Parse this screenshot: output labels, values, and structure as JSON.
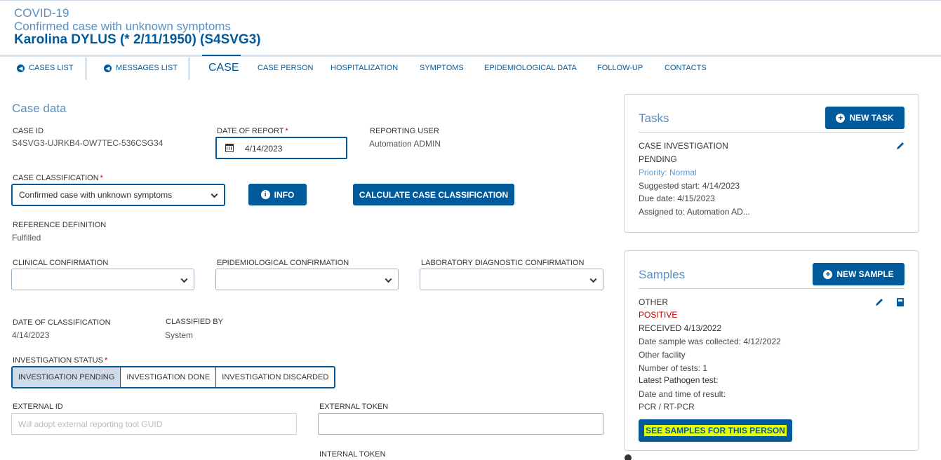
{
  "header": {
    "disease": "COVID-19",
    "classification": "Confirmed case with unknown symptoms",
    "person": "Karolina DYLUS (* 2/11/1950) (S4SVG3)"
  },
  "nav": {
    "cases_list": "CASES LIST",
    "messages_list": "MESSAGES LIST",
    "tabs": [
      "CASE",
      "CASE PERSON",
      "HOSPITALIZATION",
      "SYMPTOMS",
      "EPIDEMIOLOGICAL DATA",
      "FOLLOW-UP",
      "CONTACTS"
    ]
  },
  "case_data": {
    "title": "Case data",
    "case_id_label": "CASE ID",
    "case_id": "S4SVG3-UJRKB4-OW7TEC-536CSG34",
    "date_of_report_label": "DATE OF REPORT",
    "date_of_report": "4/14/2023",
    "reporting_user_label": "REPORTING USER",
    "reporting_user": "Automation ADMIN",
    "case_classification_label": "CASE CLASSIFICATION",
    "case_classification": "Confirmed case with unknown symptoms",
    "info_button": "INFO",
    "calculate_button": "CALCULATE CASE CLASSIFICATION",
    "reference_definition_label": "REFERENCE DEFINITION",
    "reference_definition": "Fulfilled",
    "clinical_confirmation_label": "CLINICAL CONFIRMATION",
    "epidemiological_confirmation_label": "EPIDEMIOLOGICAL CONFIRMATION",
    "laboratory_confirmation_label": "LABORATORY DIAGNOSTIC CONFIRMATION",
    "date_of_classification_label": "DATE OF CLASSIFICATION",
    "date_of_classification": "4/14/2023",
    "classified_by_label": "CLASSIFIED BY",
    "classified_by": "System",
    "investigation_status_label": "INVESTIGATION STATUS",
    "investigation_options": [
      "INVESTIGATION PENDING",
      "INVESTIGATION DONE",
      "INVESTIGATION DISCARDED"
    ],
    "investigation_selected": "INVESTIGATION PENDING",
    "external_id_label": "EXTERNAL ID",
    "external_id_placeholder": "Will adopt external reporting tool GUID",
    "external_token_label": "EXTERNAL TOKEN",
    "internal_token_label": "INTERNAL TOKEN"
  },
  "tasks": {
    "title": "Tasks",
    "new_button": "NEW TASK",
    "type": "CASE INVESTIGATION",
    "status": "PENDING",
    "priority": "Priority: Normal",
    "suggested_start": "Suggested start: 4/14/2023",
    "due_date": "Due date: 4/15/2023",
    "assigned_to": "Assigned to: Automation AD..."
  },
  "samples": {
    "title": "Samples",
    "new_button": "NEW SAMPLE",
    "type": "OTHER",
    "result": "POSITIVE",
    "received": "RECEIVED 4/13/2022",
    "collected": "Date sample was collected: 4/12/2022",
    "facility": "Other facility",
    "number_of_tests": "Number of tests: 1",
    "latest_test": "Latest Pathogen test:",
    "date_time_result": "Date and time of result:",
    "test_type": "PCR / RT-PCR",
    "see_button": "SEE SAMPLES FOR THIS PERSON"
  },
  "colors": {
    "primary": "#005a9c",
    "light_blue": "#5b8fc0",
    "positive_red": "#c00000",
    "highlight": "#e5ff00"
  }
}
